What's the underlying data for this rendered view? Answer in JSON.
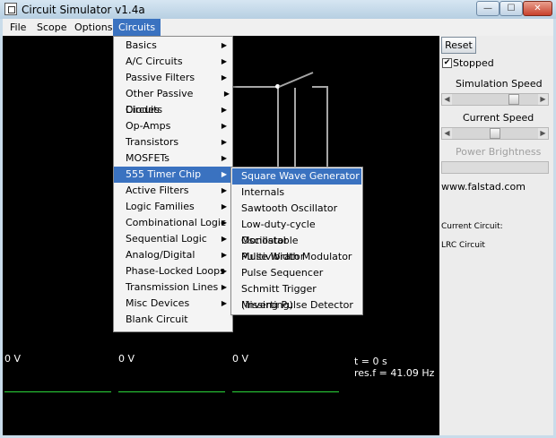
{
  "window": {
    "title": "Circuit Simulator v1.4a"
  },
  "menubar": [
    "File",
    "Scope",
    "Options",
    "Circuits"
  ],
  "circuits_menu": [
    "Basics",
    "A/C Circuits",
    "Passive Filters",
    "Other Passive Circuits",
    "Diodes",
    "Op-Amps",
    "Transistors",
    "MOSFETs",
    "555 Timer Chip",
    "Active Filters",
    "Logic Families",
    "Combinational Logic",
    "Sequential Logic",
    "Analog/Digital",
    "Phase-Locked Loops",
    "Transmission Lines",
    "Misc Devices",
    "Blank Circuit"
  ],
  "timer_submenu": [
    "Square Wave Generator",
    "Internals",
    "Sawtooth Oscillator",
    "Low-duty-cycle Oscillator",
    "Monostable Multivibrator",
    "Pulse Width Modulator",
    "Pulse Sequencer",
    "Schmitt Trigger (inverting)",
    "Missing Pulse Detector"
  ],
  "side": {
    "reset": "Reset",
    "stopped": "Stopped",
    "stopped_checked": true,
    "sim_speed": "Simulation Speed",
    "sim_speed_level": 0.75,
    "current_speed": "Current Speed",
    "current_speed_level": 0.5,
    "power_brightness": "Power Brightness",
    "website": "www.falstad.com",
    "current_circuit_label": "Current Circuit:",
    "current_circuit": "LRC Circuit"
  },
  "scope": {
    "v1": "0 V",
    "v2": "0 V",
    "v3": "0 V",
    "time": "t = 0 s",
    "res": "res.f = 41.09 Hz"
  },
  "colors": {
    "menu_highlight": "#3a72c0",
    "scope_trace": "#2bd63a"
  }
}
